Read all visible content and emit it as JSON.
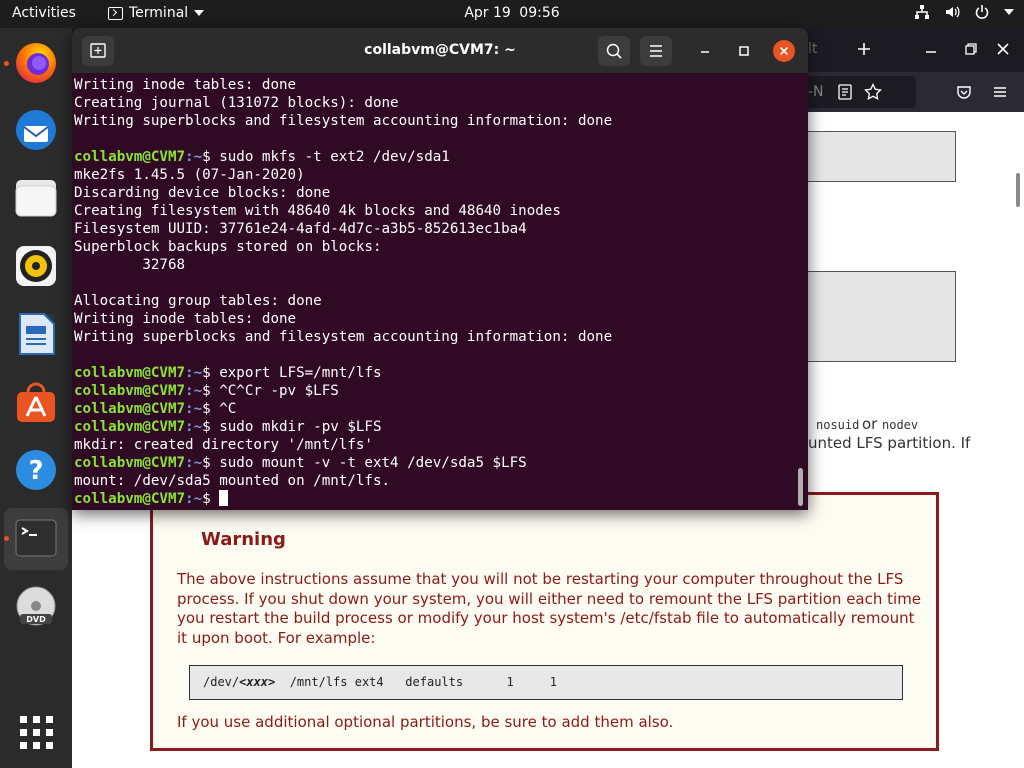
{
  "topbar": {
    "activities": "Activities",
    "app_name": "Terminal",
    "date": "Apr 19",
    "time": "09:56"
  },
  "dock": {
    "apps": [
      "firefox-icon",
      "thunderbird-icon",
      "files-icon",
      "rhythmbox-icon",
      "writer-icon",
      "software-icon",
      "help-icon",
      "terminal-icon",
      "dvd-icon",
      "app-grid-icon"
    ]
  },
  "browser": {
    "tab_fragment": "lt",
    "url_fragment": "-N",
    "frag_nosuid": "nosuid",
    "frag_or": "or",
    "frag_nodev": "nodev",
    "frag_line2": "unted LFS partition. If",
    "warning": {
      "title": "Warning",
      "body": "The above instructions assume that you will not be restarting your computer throughout the LFS process. If you shut down your system, you will either need to remount the LFS partition each time you restart the build process or modify your host system's /etc/fstab file to automatically remount it upon boot. For example:",
      "code_prefix": "/dev/",
      "code_var": "<xxx>",
      "code_rest": "  /mnt/lfs ext4   defaults      1     1",
      "footer": "If you use additional optional partitions, be sure to add them also."
    }
  },
  "terminal": {
    "title": "collabvm@CVM7: ~",
    "prompt_user": "collabvm@CVM7",
    "prompt_path": ":~",
    "prompt_symbol": "$",
    "lines": [
      {
        "type": "out",
        "text": "Writing inode tables: done"
      },
      {
        "type": "out",
        "text": "Creating journal (131072 blocks): done"
      },
      {
        "type": "out",
        "text": "Writing superblocks and filesystem accounting information: done"
      },
      {
        "type": "out",
        "text": ""
      },
      {
        "type": "cmd",
        "text": " sudo mkfs -t ext2 /dev/sda1"
      },
      {
        "type": "out",
        "text": "mke2fs 1.45.5 (07-Jan-2020)"
      },
      {
        "type": "out",
        "text": "Discarding device blocks: done"
      },
      {
        "type": "out",
        "text": "Creating filesystem with 48640 4k blocks and 48640 inodes"
      },
      {
        "type": "out",
        "text": "Filesystem UUID: 37761e24-4afd-4d7c-a3b5-852613ec1ba4"
      },
      {
        "type": "out",
        "text": "Superblock backups stored on blocks:"
      },
      {
        "type": "out",
        "text": "        32768"
      },
      {
        "type": "out",
        "text": ""
      },
      {
        "type": "out",
        "text": "Allocating group tables: done"
      },
      {
        "type": "out",
        "text": "Writing inode tables: done"
      },
      {
        "type": "out",
        "text": "Writing superblocks and filesystem accounting information: done"
      },
      {
        "type": "out",
        "text": ""
      },
      {
        "type": "cmd",
        "text": " export LFS=/mnt/lfs"
      },
      {
        "type": "cmd",
        "text": " ^C^Cr -pv $LFS"
      },
      {
        "type": "cmd",
        "text": " ^C"
      },
      {
        "type": "cmd",
        "text": " sudo mkdir -pv $LFS"
      },
      {
        "type": "out",
        "text": "mkdir: created directory '/mnt/lfs'"
      },
      {
        "type": "cmd",
        "text": " sudo mount -v -t ext4 /dev/sda5 $LFS"
      },
      {
        "type": "out",
        "text": "mount: /dev/sda5 mounted on /mnt/lfs."
      },
      {
        "type": "cursor",
        "text": " "
      }
    ]
  },
  "colors": {
    "terminal_bg": "#300a24",
    "prompt_green": "#8ae234",
    "path_blue": "#729fcf",
    "warning_red": "#8b1a1a",
    "ubuntu_orange": "#e95420"
  }
}
